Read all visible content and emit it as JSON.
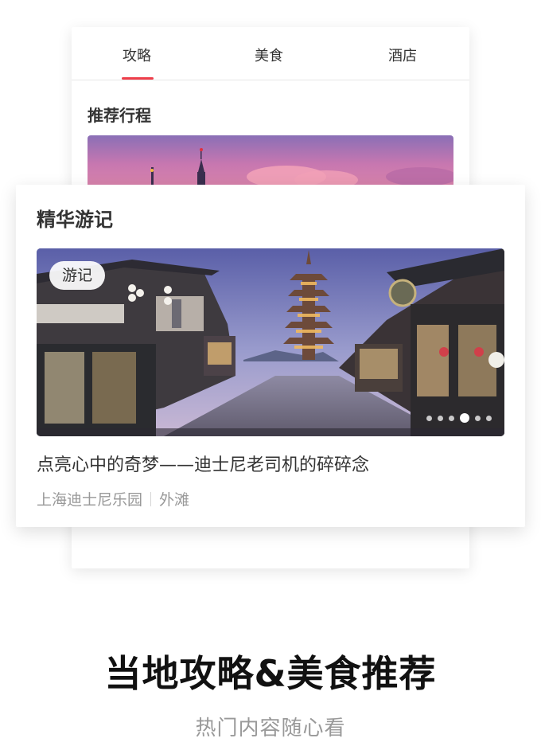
{
  "tabs": [
    {
      "label": "攻略",
      "active": true
    },
    {
      "label": "美食",
      "active": false
    },
    {
      "label": "酒店",
      "active": false
    }
  ],
  "accent_color": "#ee3e4a",
  "back_section_title": "推荐行程",
  "featured": {
    "section_title": "精华游记",
    "tag": "游记",
    "article_title": "点亮心中的奇梦——迪士尼老司机的碎碎念",
    "meta": [
      "上海迪士尼乐园",
      "外滩"
    ],
    "carousel": {
      "count": 6,
      "active_index": 3
    }
  },
  "promo": {
    "headline": "当地攻略&美食推荐",
    "subline": "热门内容随心看"
  }
}
